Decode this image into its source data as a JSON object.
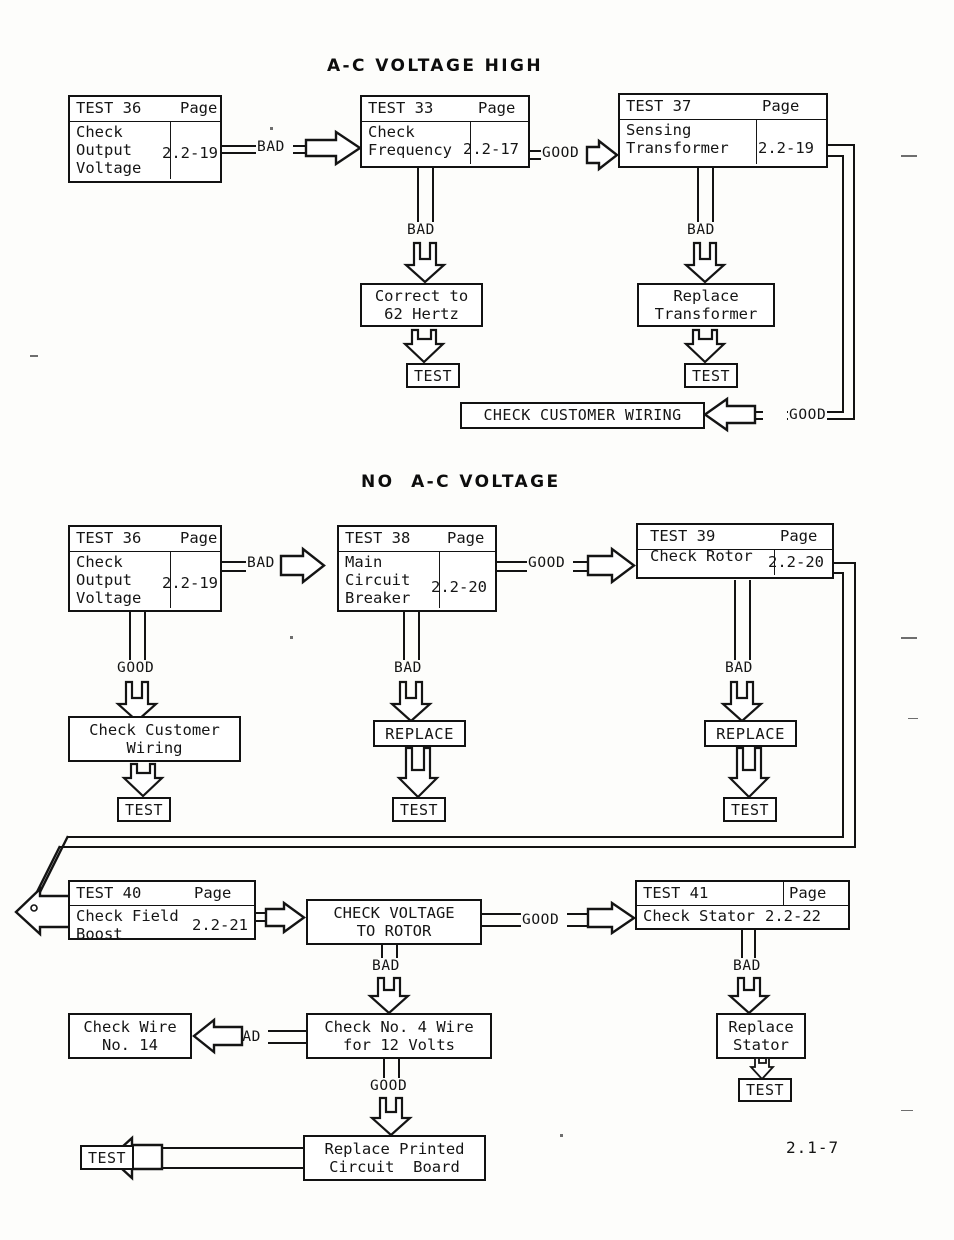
{
  "document": {
    "page_number": "2.1-7"
  },
  "sections": [
    {
      "id": "ac-voltage-high",
      "title": "A-C VOLTAGE HIGH",
      "cards": [
        {
          "id": "test36",
          "test": "TEST 36",
          "page_label": "Page",
          "name": "Check\nOutput\nVoltage",
          "page": "2.2-19"
        },
        {
          "id": "test33",
          "test": "TEST 33",
          "page_label": "Page",
          "name": "Check\nFrequency",
          "page": "2.2-17"
        },
        {
          "id": "test37",
          "test": "TEST 37",
          "page_label": "Page",
          "name": "Sensing\nTransformer",
          "page": "2.2-19"
        }
      ],
      "actions": [
        {
          "id": "correct-hertz",
          "text": "Correct to\n62 Hertz"
        },
        {
          "id": "replace-transformer",
          "text": "Replace\nTransformer"
        },
        {
          "id": "check-customer-wiring-caps",
          "text": "CHECK CUSTOMER WIRING"
        }
      ],
      "terminals": [
        {
          "id": "test-after-hertz",
          "text": "TEST"
        },
        {
          "id": "test-after-transformer",
          "text": "TEST"
        }
      ],
      "edges": [
        {
          "id": "e36-33",
          "label": "BAD"
        },
        {
          "id": "e33-37",
          "label": "GOOD"
        },
        {
          "id": "e33-hertz",
          "label": "BAD"
        },
        {
          "id": "e37-transformer",
          "label": "BAD"
        },
        {
          "id": "e37-wiring",
          "label": "GOOD"
        }
      ]
    },
    {
      "id": "no-ac-voltage",
      "title": "NO  A-C VOLTAGE",
      "cards": [
        {
          "id": "test36b",
          "test": "TEST 36",
          "page_label": "Page",
          "name": "Check\nOutput\nVoltage",
          "page": "2.2-19"
        },
        {
          "id": "test38",
          "test": "TEST 38",
          "page_label": "Page",
          "name": "Main\nCircuit\nBreaker",
          "page": "2.2-20"
        },
        {
          "id": "test39",
          "test": "TEST 39",
          "page_label": "Page",
          "name": "Check Rotor",
          "page": "2.2-20"
        },
        {
          "id": "test40",
          "test": "TEST 40",
          "page_label": "Page",
          "name": "Check Field\nBoost",
          "page": "2.2-21"
        },
        {
          "id": "test41",
          "test": "TEST 41",
          "page_label": "Page",
          "name": "Check Stator",
          "page": "2.2-22"
        }
      ],
      "actions": [
        {
          "id": "check-customer-wiring",
          "text": "Check Customer\nWiring"
        },
        {
          "id": "replace-breaker",
          "text": "REPLACE"
        },
        {
          "id": "replace-rotor",
          "text": "REPLACE"
        },
        {
          "id": "check-voltage-rotor",
          "text": "CHECK VOLTAGE\nTO ROTOR"
        },
        {
          "id": "check-wire-14",
          "text": "Check Wire\nNo. 14"
        },
        {
          "id": "check-no4-wire",
          "text": "Check No. 4 Wire\nfor 12 Volts"
        },
        {
          "id": "replace-pcb",
          "text": "Replace Printed\nCircuit  Board"
        },
        {
          "id": "replace-stator",
          "text": "Replace\nStator"
        }
      ],
      "terminals": [
        {
          "id": "test-after-wiring",
          "text": "TEST"
        },
        {
          "id": "test-after-breaker",
          "text": "TEST"
        },
        {
          "id": "test-after-rotor",
          "text": "TEST"
        },
        {
          "id": "test-after-stator",
          "text": "TEST"
        },
        {
          "id": "test-after-pcb",
          "text": "TEST"
        }
      ],
      "edges": [
        {
          "id": "e36b-38",
          "label": "BAD"
        },
        {
          "id": "e38-39",
          "label": "GOOD"
        },
        {
          "id": "e36b-wiring",
          "label": "GOOD"
        },
        {
          "id": "e38-replace",
          "label": "BAD"
        },
        {
          "id": "e39-replace",
          "label": "BAD"
        },
        {
          "id": "e40-rotorvolt-good",
          "label": "GOOD"
        },
        {
          "id": "e-rotorvolt-bad",
          "label": "BAD"
        },
        {
          "id": "e-no4-bad",
          "label": "BAD"
        },
        {
          "id": "e-no4-good",
          "label": "GOOD"
        },
        {
          "id": "e41-bad",
          "label": "BAD"
        }
      ]
    }
  ]
}
